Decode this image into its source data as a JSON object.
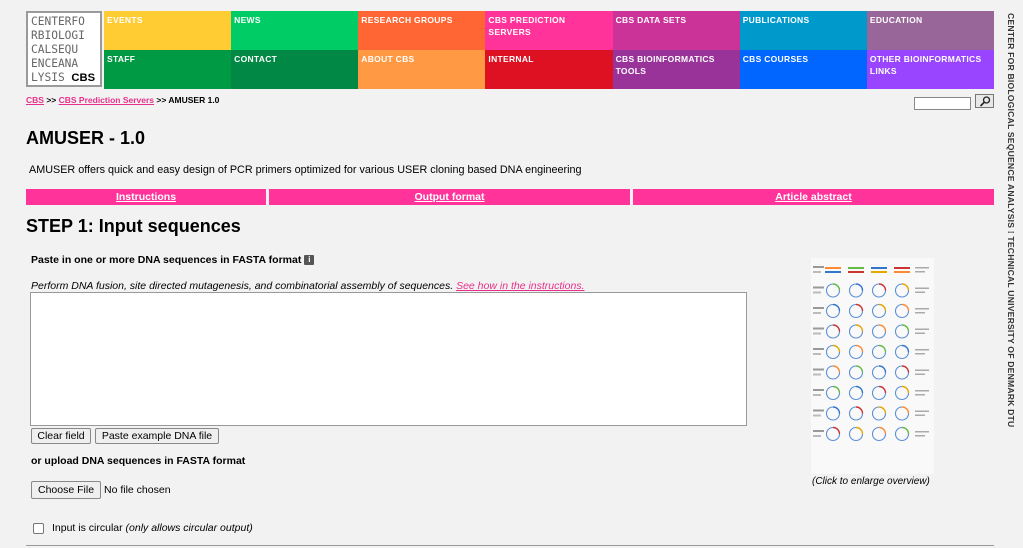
{
  "logo": {
    "lines": [
      "CENTERFO",
      "RBIOLOGI",
      "CALSEQU",
      "ENCEANA",
      "LYSIS "
    ],
    "cbs_text": "CBS"
  },
  "nav": {
    "top": [
      {
        "label": "EVENTS",
        "color": "#ffcc33"
      },
      {
        "label": "NEWS",
        "color": "#00cc66"
      },
      {
        "label": "RESEARCH GROUPS",
        "color": "#ff6633"
      },
      {
        "label": "CBS PREDICTION SERVERS",
        "color": "#ff3399"
      },
      {
        "label": "CBS DATA SETS",
        "color": "#cc3399"
      },
      {
        "label": "PUBLICATIONS",
        "color": "#0099cc"
      },
      {
        "label": "EDUCATION",
        "color": "#996699"
      }
    ],
    "bottom": [
      {
        "label": "STAFF",
        "color": "#009944"
      },
      {
        "label": "CONTACT",
        "color": "#008844"
      },
      {
        "label": "ABOUT CBS",
        "color": "#ff9944"
      },
      {
        "label": "INTERNAL",
        "color": "#dd1122"
      },
      {
        "label": "CBS BIOINFORMATICS TOOLS",
        "color": "#993399"
      },
      {
        "label": "CBS COURSES",
        "color": "#0066ff"
      },
      {
        "label": "OTHER BIOINFORMATICS LINKS",
        "color": "#9944ff"
      }
    ]
  },
  "breadcrumb": {
    "home": "CBS",
    "sep1": " >> ",
    "servers": "CBS Prediction Servers",
    "sep2": " >> ",
    "current": "AMUSER 1.0"
  },
  "side_text": "CENTER FOR BIOLOGICAL SEQUENCE ANALYSIS  ⁞  TECHNICAL UNIVERSITY OF DENMARK DTU",
  "page": {
    "title": "AMUSER - 1.0",
    "description": "AMUSER offers quick and easy design of PCR primers optimized for various USER cloning based DNA engineering"
  },
  "tabs": [
    {
      "label": "Instructions"
    },
    {
      "label": "Output format"
    },
    {
      "label": "Article abstract"
    }
  ],
  "step1": {
    "heading": "STEP 1: Input sequences",
    "paste_label": "Paste in one or more DNA sequences in FASTA format",
    "hint_text": "Perform DNA fusion, site directed mutagenesis, and combinatorial assembly of sequences. ",
    "hint_link": "See how in the instructions.",
    "textarea_value": "",
    "clear_button": "Clear field",
    "example_button": "Paste example DNA file",
    "upload_label": "or upload DNA sequences in FASTA format",
    "choose_file_button": "Choose File",
    "file_status": "No file chosen",
    "circular_label": "Input is circular ",
    "circular_note": "(only allows circular output)",
    "circular_checked": false
  },
  "overview": {
    "caption": "(Click to enlarge overview)"
  }
}
